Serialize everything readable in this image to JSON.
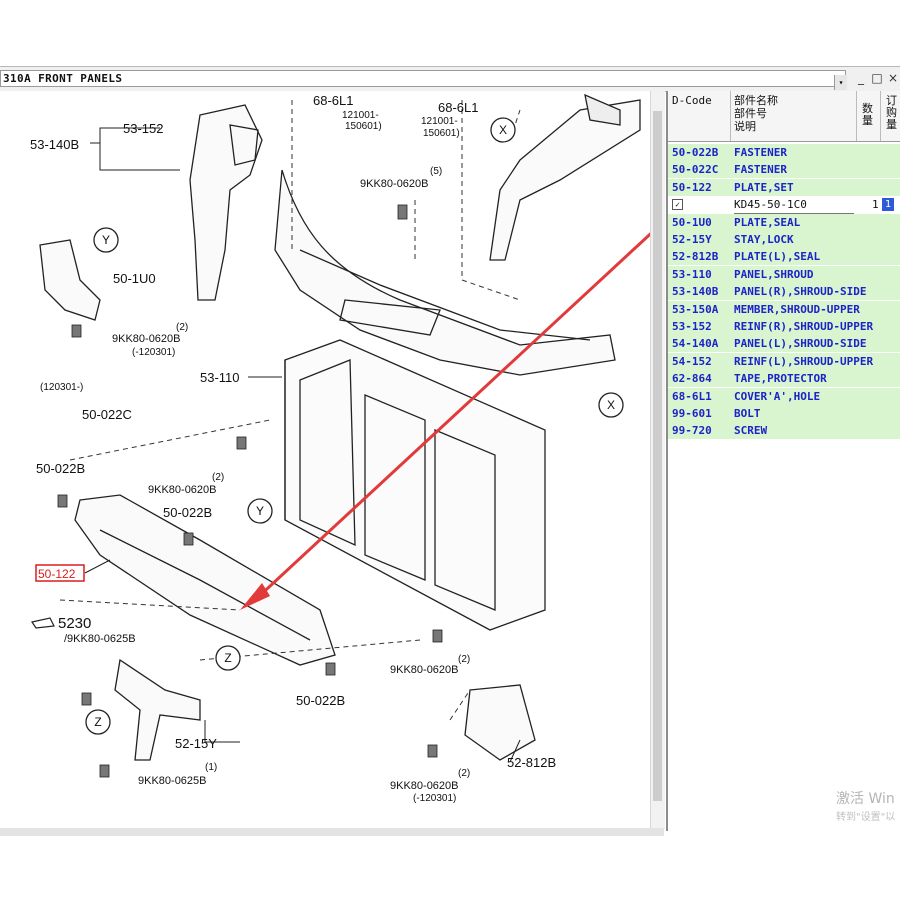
{
  "window": {
    "title": "310A  FRONT PANELS",
    "dropdown_arrow": "▾",
    "btn_minimize": "_",
    "btn_restore": "□",
    "btn_close": "×"
  },
  "diagram": {
    "labels": {
      "l_53_140B": "53-140B",
      "l_53_152": "53-152",
      "l_68_6L1_a": "68-6L1",
      "l_121001_a": "121001-",
      "l_150601_a": "150601)",
      "l_68_6L1_b": "68-6L1",
      "l_121001_b": "121001-",
      "l_150601_b": "150601)",
      "l_cnt5": "(5)",
      "l_9KK80_top": "9KK80-0620B",
      "l_X1": "X",
      "l_Y1": "Y",
      "l_50_1U0": "50-1U0",
      "l_cnt2a": "(2)",
      "l_9KK80_a": "9KK80-0620B",
      "l_120301_a": "(-120301)",
      "l_53_110": "53-110",
      "l_120301_b": "(120301-)",
      "l_50_022C": "50-022C",
      "l_X2": "X",
      "l_50_022B_a": "50-022B",
      "l_cnt2b": "(2)",
      "l_9KK80_b": "9KK80-0620B",
      "l_50_022B_b": "50-022B",
      "l_Y2": "Y",
      "l_50_122": "50-122",
      "l_5230": "5230",
      "l_9KK80_0625B_a": "/9KK80-0625B",
      "l_Z1": "Z",
      "l_cnt2c": "(2)",
      "l_9KK80_c": "9KK80-0620B",
      "l_50_022B_c": "50-022B",
      "l_Z2": "Z",
      "l_52_15Y": "52-15Y",
      "l_cnt1": "(1)",
      "l_9KK80_0625B_b": "9KK80-0625B",
      "l_52_812B": "52-812B",
      "l_cnt2d": "(2)",
      "l_9KK80_d": "9KK80-0620B",
      "l_120301_c": "(-120301)"
    },
    "highlight_color": "#d81e1e",
    "arrow_color": "#e23a3a"
  },
  "parts_table": {
    "headers": {
      "dcode": "D-Code",
      "name_line1": "部件名称",
      "name_line2": "部件号",
      "name_line3": "说明",
      "qty": "数\n量",
      "order": "订\n购\n量"
    },
    "rows": [
      {
        "code": "50-022B",
        "name": "FASTENER"
      },
      {
        "code": "50-022C",
        "name": "FASTENER"
      },
      {
        "code": "50-122",
        "name": "PLATE,SET"
      },
      {
        "code": "",
        "name": ""
      },
      {
        "code": "50-1U0",
        "name": "PLATE,SEAL"
      },
      {
        "code": "52-15Y",
        "name": "STAY,LOCK"
      },
      {
        "code": "52-812B",
        "name": "PLATE(L),SEAL"
      },
      {
        "code": "53-110",
        "name": "PANEL,SHROUD"
      },
      {
        "code": "53-140B",
        "name": "PANEL(R),SHROUD-SIDE"
      },
      {
        "code": "53-150A",
        "name": "MEMBER,SHROUD-UPPER"
      },
      {
        "code": "53-152",
        "name": "REINF(R),SHROUD-UPPER"
      },
      {
        "code": "54-140A",
        "name": "PANEL(L),SHROUD-SIDE"
      },
      {
        "code": "54-152",
        "name": "REINF(L),SHROUD-UPPER"
      },
      {
        "code": "62-864",
        "name": "TAPE,PROTECTOR"
      },
      {
        "code": "68-6L1",
        "name": "COVER'A',HOLE"
      },
      {
        "code": "99-601",
        "name": "BOLT"
      },
      {
        "code": "99-720",
        "name": "SCREW"
      }
    ],
    "selected_row": {
      "checkbox": "✓",
      "part_number": "KD45-50-1C0",
      "qty": "1",
      "order": "1"
    },
    "row_bg": "#d8f5d0",
    "row_text": "#1c23c8"
  },
  "watermark": {
    "line1": "激活 Win",
    "line2": "转到\"设置\"以"
  }
}
